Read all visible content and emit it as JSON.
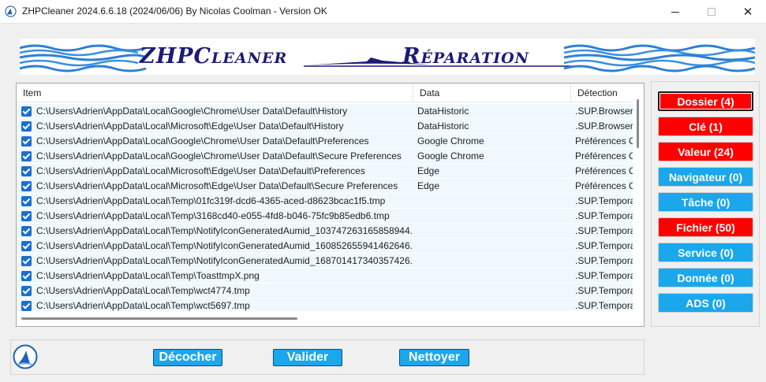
{
  "window": {
    "title": "ZHPCleaner 2024.6.6.18 (2024/06/06) By Nicolas Coolman - Version OK",
    "minimize_glyph": "",
    "close_glyph": "✕"
  },
  "banner": {
    "left_text": "ZHPCleaner",
    "right_text": "Réparation"
  },
  "list": {
    "columns": [
      "Item",
      "Data",
      "Détection"
    ],
    "rows": [
      {
        "item": "C:\\Users\\Adrien\\AppData\\Local\\Google\\Chrome\\User Data\\Default\\History",
        "data": "DataHistoric",
        "detection": ".SUP.BrowserHistory",
        "checked": true
      },
      {
        "item": "C:\\Users\\Adrien\\AppData\\Local\\Microsoft\\Edge\\User Data\\Default\\History",
        "data": "DataHistoric",
        "detection": ".SUP.BrowserHistory",
        "checked": true
      },
      {
        "item": "C:\\Users\\Adrien\\AppData\\Local\\Google\\Chrome\\User Data\\Default\\Preferences",
        "data": "Google Chrome",
        "detection": "Préférences Chrome",
        "checked": true
      },
      {
        "item": "C:\\Users\\Adrien\\AppData\\Local\\Google\\Chrome\\User Data\\Default\\Secure Preferences",
        "data": "Google Chrome",
        "detection": "Préférences Chrome",
        "checked": true
      },
      {
        "item": "C:\\Users\\Adrien\\AppData\\Local\\Microsoft\\Edge\\User Data\\Default\\Preferences",
        "data": "Edge",
        "detection": "Préférences Chrome",
        "checked": true
      },
      {
        "item": "C:\\Users\\Adrien\\AppData\\Local\\Microsoft\\Edge\\User Data\\Default\\Secure Preferences",
        "data": "Edge",
        "detection": "Préférences Chrome",
        "checked": true
      },
      {
        "item": "C:\\Users\\Adrien\\AppData\\Local\\Temp\\01fc319f-dcd6-4365-aced-d8623bcac1f5.tmp",
        "data": "",
        "detection": ".SUP.Temporary",
        "checked": true
      },
      {
        "item": "C:\\Users\\Adrien\\AppData\\Local\\Temp\\3168cd40-e055-4fd8-b046-75fc9b85edb6.tmp",
        "data": "",
        "detection": ".SUP.Temporary",
        "checked": true
      },
      {
        "item": "C:\\Users\\Adrien\\AppData\\Local\\Temp\\NotifyIconGeneratedAumid_103747263165858944...",
        "data": "",
        "detection": ".SUP.Temporary",
        "checked": true
      },
      {
        "item": "C:\\Users\\Adrien\\AppData\\Local\\Temp\\NotifyIconGeneratedAumid_160852655941462646...",
        "data": "",
        "detection": ".SUP.Temporary",
        "checked": true
      },
      {
        "item": "C:\\Users\\Adrien\\AppData\\Local\\Temp\\NotifyIconGeneratedAumid_168701417340357426...",
        "data": "",
        "detection": ".SUP.Temporary",
        "checked": true
      },
      {
        "item": "C:\\Users\\Adrien\\AppData\\Local\\Temp\\ToasttmpX.png",
        "data": "",
        "detection": ".SUP.Temporary",
        "checked": true
      },
      {
        "item": "C:\\Users\\Adrien\\AppData\\Local\\Temp\\wct4774.tmp",
        "data": "",
        "detection": ".SUP.Temporary",
        "checked": true
      },
      {
        "item": "C:\\Users\\Adrien\\AppData\\Local\\Temp\\wct5697.tmp",
        "data": "",
        "detection": ".SUP.Temporary",
        "checked": true
      }
    ]
  },
  "categories": [
    {
      "label": "Dossier  (4)",
      "color": "#ff0000",
      "key": "dossier"
    },
    {
      "label": "Clé  (1)",
      "color": "#ff0000",
      "key": "cle"
    },
    {
      "label": "Valeur  (24)",
      "color": "#ff0000",
      "key": "valeur"
    },
    {
      "label": "Navigateur  (0)",
      "color": "#1aa7ec",
      "key": "navigateur"
    },
    {
      "label": "Tâche  (0)",
      "color": "#1aa7ec",
      "key": "tache"
    },
    {
      "label": "Fichier  (50)",
      "color": "#ff0000",
      "key": "fichier"
    },
    {
      "label": "Service  (0)",
      "color": "#1aa7ec",
      "key": "service"
    },
    {
      "label": "Donnée  (0)",
      "color": "#1aa7ec",
      "key": "donnee"
    },
    {
      "label": "ADS  (0)",
      "color": "#1aa7ec",
      "key": "ads"
    }
  ],
  "actions": {
    "uncheck_label": "Décocher",
    "validate_label": "Valider",
    "clean_label": "Nettoyer"
  },
  "colors": {
    "accent_blue": "#1aa7ec",
    "alert_red": "#ff0000",
    "row_background": "#eef8fd",
    "banner_text": "#1b1b78"
  }
}
